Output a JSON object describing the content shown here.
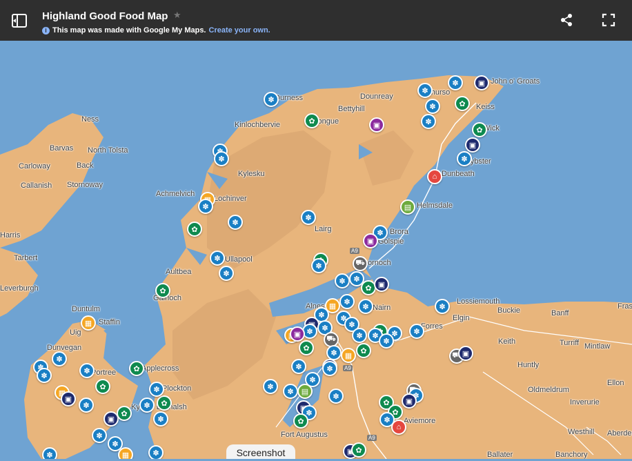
{
  "header": {
    "title": "Highland Good Food Map",
    "info_text": "This map was made with Google My Maps.",
    "info_link": "Create your own."
  },
  "colors": {
    "sea": "#6fa3d2",
    "land": "#e8b57c",
    "header_bg": "#2f2f2f",
    "marker_wheat": "#1a7fc4",
    "marker_green": "#0e8a4f",
    "marker_shop": "#1e2a6e",
    "marker_purple": "#8b2a9e",
    "marker_red": "#e5473f",
    "marker_orange": "#f5a623",
    "marker_gray": "#666666",
    "marker_lime": "#6daa3d"
  },
  "map": {
    "places": {
      "john_o_groats": "John o' Groats",
      "dounreay": "Dounreay",
      "thurso": "Thurso",
      "bettyhill": "Bettyhill",
      "durness": "Durness",
      "keiss": "Keiss",
      "tongue": "Tongue",
      "kinlochbervie": "Kinlochbervie",
      "wick": "Wick",
      "ness": "Ness",
      "barvas": "Barvas",
      "north_tolsta": "North Tolsta",
      "carloway": "Carloway",
      "back": "Back",
      "callanish": "Callanish",
      "stornoway": "Stornoway",
      "kylesku": "Kylesku",
      "lybster": "Lybster",
      "dunbeath": "Dunbeath",
      "achmelvich": "Achmelvich",
      "lochinver": "Lochinver",
      "helmsdale": "Helmsdale",
      "harris": "Harris",
      "lairg": "Lairg",
      "brora": "Brora",
      "golspie": "Golspie",
      "tarbert": "Tarbert",
      "ullapool": "Ullapool",
      "dornoch": "Dornoch",
      "aultbea": "Aultbea",
      "leverburgh": "Leverburgh",
      "gairloch": "Gairloch",
      "lossiemouth": "Lossiemouth",
      "alness": "Alness",
      "nairn": "Nairn",
      "duntulm": "Duntulm",
      "staffin": "Staffin",
      "elgin": "Elgin",
      "buckie": "Buckie",
      "banff": "Banff",
      "fraserburgh": "Fras",
      "uig": "Uig",
      "forres": "Forres",
      "keith": "Keith",
      "turriff": "Turriff",
      "mintlaw": "Mintlaw",
      "dunvegan": "Dunvegan",
      "portree": "Portree",
      "applecross": "Applecross",
      "huntly": "Huntly",
      "ellon": "Ellon",
      "plockton": "Plockton",
      "lochalsh": "Kyle of Lochalsh",
      "oldmeldrum": "Oldmeldrum",
      "inverurie": "Inverurie",
      "aviemore": "Aviemore",
      "westhill": "Westhill",
      "aberdeen": "Aberdee",
      "fort_augustus": "Fort Augustus",
      "ballater": "Ballater",
      "banchory": "Banchory"
    },
    "roads": {
      "a9_north": "A9",
      "a9_mid": "A9",
      "a9_south": "A9"
    }
  },
  "screenshot_label": "Screenshot"
}
